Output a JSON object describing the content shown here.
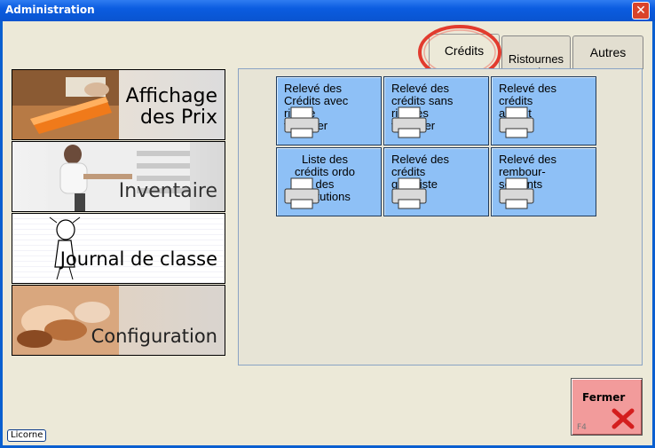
{
  "window": {
    "title": "Administration"
  },
  "nav": [
    {
      "label": "Affichage\ndes Prix"
    },
    {
      "label": "Inventaire"
    },
    {
      "label": "Journal de classe"
    },
    {
      "label": "Configuration"
    }
  ],
  "tabs": [
    {
      "label": "Crédits",
      "active": true
    },
    {
      "label": "Ristournes\nRemises",
      "active": false
    },
    {
      "label": "Autres",
      "active": false
    }
  ],
  "reports": [
    {
      "label": "Relevé des\nCrédits avec\nrisque\nfinancier"
    },
    {
      "label": "Relevé des\ncrédits sans\nrisques\nfinancier"
    },
    {
      "label": "Relevé des\ncrédits\nargent"
    },
    {
      "label": "Liste des\ncrédits ordo\ndes\ninsitutions"
    },
    {
      "label": "Relevé des\ncrédits\ngrossiste"
    },
    {
      "label": "Relevé des\nrembour-\nsements\nargent"
    }
  ],
  "close_button": {
    "label": "Fermer",
    "shortcut": "F4"
  },
  "footer": {
    "licorne": "Licorne"
  },
  "colors": {
    "titlebar": "#0b5ce0",
    "report_tile": "#8ec0f6",
    "close_tile": "#f29b9b",
    "highlight_circle": "#e23b2e"
  }
}
